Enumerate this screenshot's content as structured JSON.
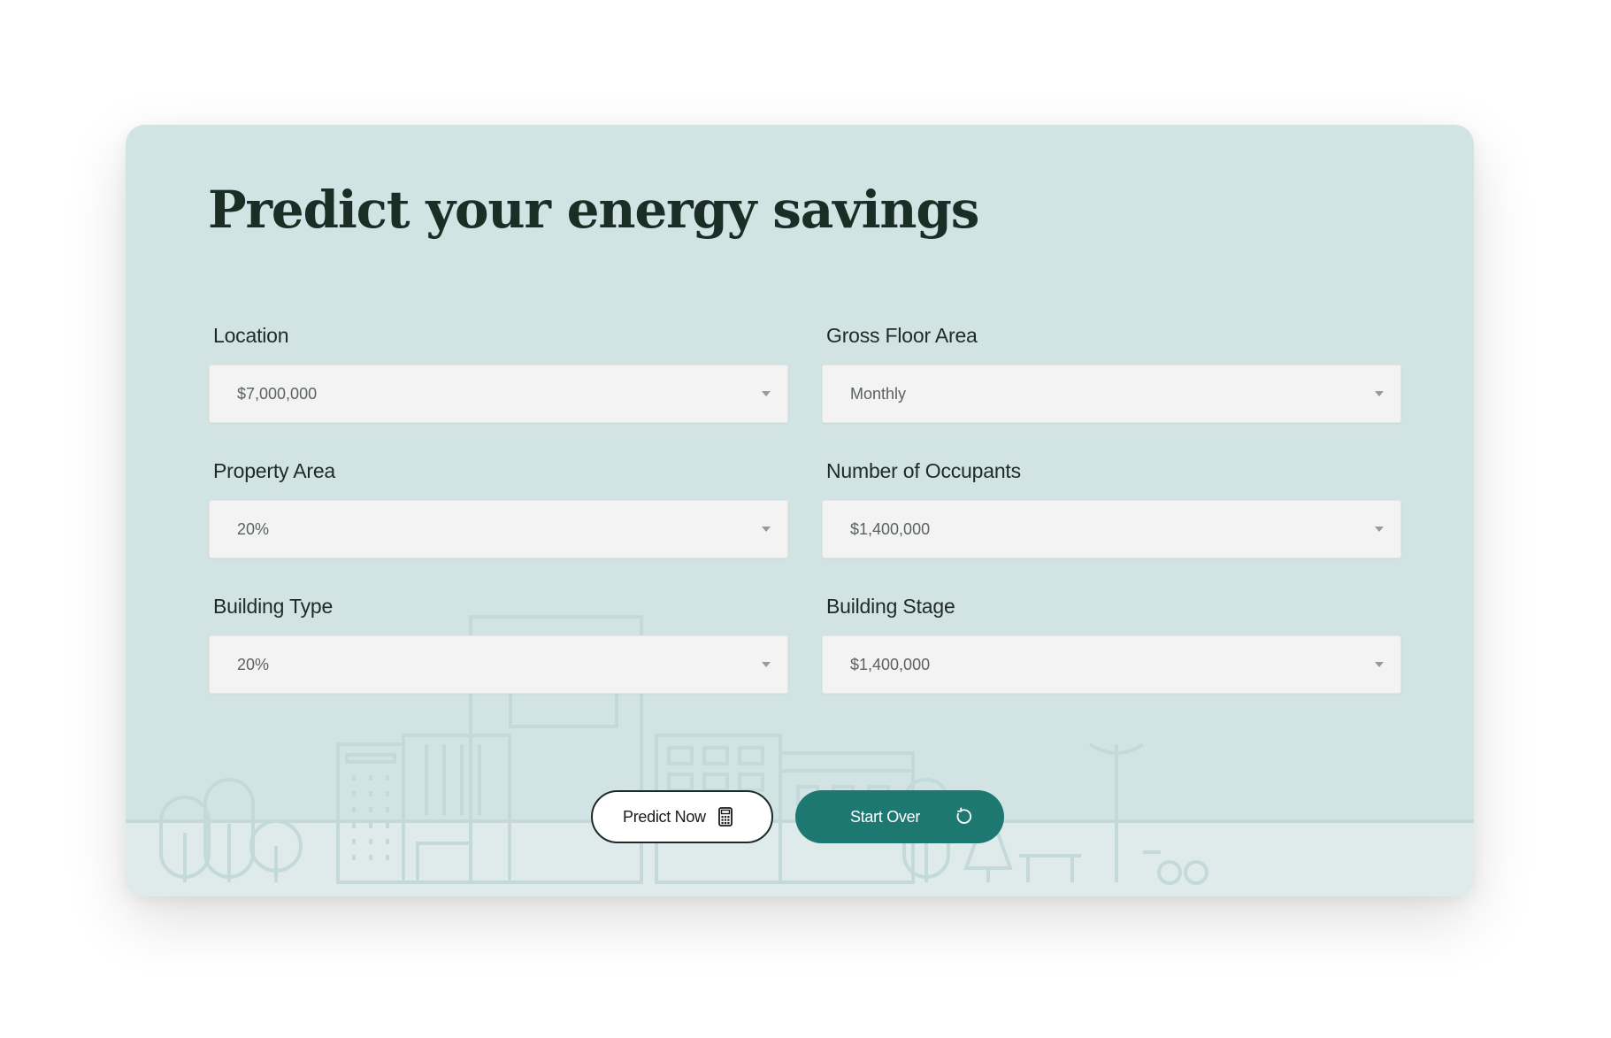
{
  "page": {
    "title": "Predict your energy savings"
  },
  "form": {
    "fields": [
      {
        "label": "Location",
        "value": "$7,000,000"
      },
      {
        "label": "Gross Floor Area",
        "value": "Monthly"
      },
      {
        "label": "Property Area",
        "value": "20%"
      },
      {
        "label": "Number of Occupants",
        "value": "$1,400,000"
      },
      {
        "label": "Building Type",
        "value": "20%"
      },
      {
        "label": "Building Stage",
        "value": "$1,400,000"
      }
    ]
  },
  "actions": {
    "predict_label": "Predict Now",
    "predict_icon": "calculator-icon",
    "reset_label": "Start Over",
    "reset_icon": "refresh-icon"
  },
  "colors": {
    "card_background": "#d2e3e3",
    "primary_button": "#1d7872",
    "title_text": "#1a2e26",
    "select_background": "#f3f3f3"
  }
}
